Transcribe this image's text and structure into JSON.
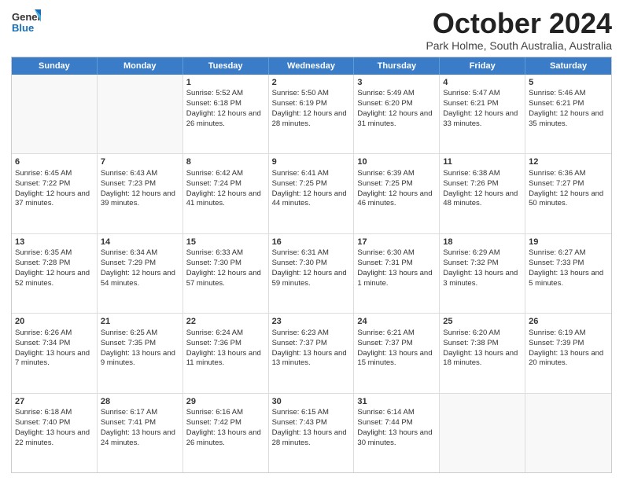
{
  "logo": {
    "general": "General",
    "blue": "Blue"
  },
  "header": {
    "month": "October 2024",
    "location": "Park Holme, South Australia, Australia"
  },
  "weekdays": [
    "Sunday",
    "Monday",
    "Tuesday",
    "Wednesday",
    "Thursday",
    "Friday",
    "Saturday"
  ],
  "weeks": [
    [
      {
        "day": "",
        "sunrise": "",
        "sunset": "",
        "daylight": "",
        "empty": true
      },
      {
        "day": "",
        "sunrise": "",
        "sunset": "",
        "daylight": "",
        "empty": true
      },
      {
        "day": "1",
        "sunrise": "Sunrise: 5:52 AM",
        "sunset": "Sunset: 6:18 PM",
        "daylight": "Daylight: 12 hours and 26 minutes."
      },
      {
        "day": "2",
        "sunrise": "Sunrise: 5:50 AM",
        "sunset": "Sunset: 6:19 PM",
        "daylight": "Daylight: 12 hours and 28 minutes."
      },
      {
        "day": "3",
        "sunrise": "Sunrise: 5:49 AM",
        "sunset": "Sunset: 6:20 PM",
        "daylight": "Daylight: 12 hours and 31 minutes."
      },
      {
        "day": "4",
        "sunrise": "Sunrise: 5:47 AM",
        "sunset": "Sunset: 6:21 PM",
        "daylight": "Daylight: 12 hours and 33 minutes."
      },
      {
        "day": "5",
        "sunrise": "Sunrise: 5:46 AM",
        "sunset": "Sunset: 6:21 PM",
        "daylight": "Daylight: 12 hours and 35 minutes."
      }
    ],
    [
      {
        "day": "6",
        "sunrise": "Sunrise: 6:45 AM",
        "sunset": "Sunset: 7:22 PM",
        "daylight": "Daylight: 12 hours and 37 minutes."
      },
      {
        "day": "7",
        "sunrise": "Sunrise: 6:43 AM",
        "sunset": "Sunset: 7:23 PM",
        "daylight": "Daylight: 12 hours and 39 minutes."
      },
      {
        "day": "8",
        "sunrise": "Sunrise: 6:42 AM",
        "sunset": "Sunset: 7:24 PM",
        "daylight": "Daylight: 12 hours and 41 minutes."
      },
      {
        "day": "9",
        "sunrise": "Sunrise: 6:41 AM",
        "sunset": "Sunset: 7:25 PM",
        "daylight": "Daylight: 12 hours and 44 minutes."
      },
      {
        "day": "10",
        "sunrise": "Sunrise: 6:39 AM",
        "sunset": "Sunset: 7:25 PM",
        "daylight": "Daylight: 12 hours and 46 minutes."
      },
      {
        "day": "11",
        "sunrise": "Sunrise: 6:38 AM",
        "sunset": "Sunset: 7:26 PM",
        "daylight": "Daylight: 12 hours and 48 minutes."
      },
      {
        "day": "12",
        "sunrise": "Sunrise: 6:36 AM",
        "sunset": "Sunset: 7:27 PM",
        "daylight": "Daylight: 12 hours and 50 minutes."
      }
    ],
    [
      {
        "day": "13",
        "sunrise": "Sunrise: 6:35 AM",
        "sunset": "Sunset: 7:28 PM",
        "daylight": "Daylight: 12 hours and 52 minutes."
      },
      {
        "day": "14",
        "sunrise": "Sunrise: 6:34 AM",
        "sunset": "Sunset: 7:29 PM",
        "daylight": "Daylight: 12 hours and 54 minutes."
      },
      {
        "day": "15",
        "sunrise": "Sunrise: 6:33 AM",
        "sunset": "Sunset: 7:30 PM",
        "daylight": "Daylight: 12 hours and 57 minutes."
      },
      {
        "day": "16",
        "sunrise": "Sunrise: 6:31 AM",
        "sunset": "Sunset: 7:30 PM",
        "daylight": "Daylight: 12 hours and 59 minutes."
      },
      {
        "day": "17",
        "sunrise": "Sunrise: 6:30 AM",
        "sunset": "Sunset: 7:31 PM",
        "daylight": "Daylight: 13 hours and 1 minute."
      },
      {
        "day": "18",
        "sunrise": "Sunrise: 6:29 AM",
        "sunset": "Sunset: 7:32 PM",
        "daylight": "Daylight: 13 hours and 3 minutes."
      },
      {
        "day": "19",
        "sunrise": "Sunrise: 6:27 AM",
        "sunset": "Sunset: 7:33 PM",
        "daylight": "Daylight: 13 hours and 5 minutes."
      }
    ],
    [
      {
        "day": "20",
        "sunrise": "Sunrise: 6:26 AM",
        "sunset": "Sunset: 7:34 PM",
        "daylight": "Daylight: 13 hours and 7 minutes."
      },
      {
        "day": "21",
        "sunrise": "Sunrise: 6:25 AM",
        "sunset": "Sunset: 7:35 PM",
        "daylight": "Daylight: 13 hours and 9 minutes."
      },
      {
        "day": "22",
        "sunrise": "Sunrise: 6:24 AM",
        "sunset": "Sunset: 7:36 PM",
        "daylight": "Daylight: 13 hours and 11 minutes."
      },
      {
        "day": "23",
        "sunrise": "Sunrise: 6:23 AM",
        "sunset": "Sunset: 7:37 PM",
        "daylight": "Daylight: 13 hours and 13 minutes."
      },
      {
        "day": "24",
        "sunrise": "Sunrise: 6:21 AM",
        "sunset": "Sunset: 7:37 PM",
        "daylight": "Daylight: 13 hours and 15 minutes."
      },
      {
        "day": "25",
        "sunrise": "Sunrise: 6:20 AM",
        "sunset": "Sunset: 7:38 PM",
        "daylight": "Daylight: 13 hours and 18 minutes."
      },
      {
        "day": "26",
        "sunrise": "Sunrise: 6:19 AM",
        "sunset": "Sunset: 7:39 PM",
        "daylight": "Daylight: 13 hours and 20 minutes."
      }
    ],
    [
      {
        "day": "27",
        "sunrise": "Sunrise: 6:18 AM",
        "sunset": "Sunset: 7:40 PM",
        "daylight": "Daylight: 13 hours and 22 minutes."
      },
      {
        "day": "28",
        "sunrise": "Sunrise: 6:17 AM",
        "sunset": "Sunset: 7:41 PM",
        "daylight": "Daylight: 13 hours and 24 minutes."
      },
      {
        "day": "29",
        "sunrise": "Sunrise: 6:16 AM",
        "sunset": "Sunset: 7:42 PM",
        "daylight": "Daylight: 13 hours and 26 minutes."
      },
      {
        "day": "30",
        "sunrise": "Sunrise: 6:15 AM",
        "sunset": "Sunset: 7:43 PM",
        "daylight": "Daylight: 13 hours and 28 minutes."
      },
      {
        "day": "31",
        "sunrise": "Sunrise: 6:14 AM",
        "sunset": "Sunset: 7:44 PM",
        "daylight": "Daylight: 13 hours and 30 minutes."
      },
      {
        "day": "",
        "sunrise": "",
        "sunset": "",
        "daylight": "",
        "empty": true
      },
      {
        "day": "",
        "sunrise": "",
        "sunset": "",
        "daylight": "",
        "empty": true
      }
    ]
  ]
}
